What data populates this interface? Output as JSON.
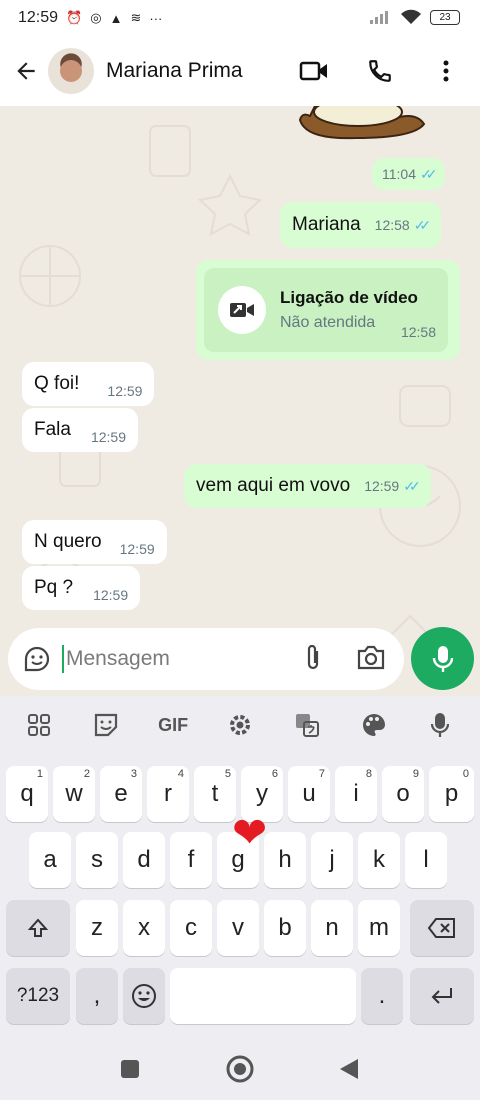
{
  "status_bar": {
    "time": "12:59",
    "battery": "23"
  },
  "header": {
    "contact_name": "Mariana Prima"
  },
  "messages": [
    {
      "dir": "out",
      "text": "",
      "time": "11:04"
    },
    {
      "dir": "out",
      "text": "Mariana",
      "time": "12:58"
    },
    {
      "dir": "out",
      "type": "call",
      "title": "Ligação de vídeo",
      "subtitle": "Não atendida",
      "time": "12:58"
    },
    {
      "dir": "in",
      "text": "Q foi!",
      "time": "12:59"
    },
    {
      "dir": "in",
      "text": "Fala",
      "time": "12:59"
    },
    {
      "dir": "out",
      "text": "vem aqui em vovo",
      "time": "12:59"
    },
    {
      "dir": "in",
      "text": "N quero",
      "time": "12:59"
    },
    {
      "dir": "in",
      "text": "Pq ?",
      "time": "12:59"
    }
  ],
  "compose": {
    "placeholder": "Mensagem"
  },
  "keyboard": {
    "toolbar": {
      "gif_label": "GIF"
    },
    "row1": [
      {
        "k": "q",
        "h": "1"
      },
      {
        "k": "w",
        "h": "2"
      },
      {
        "k": "e",
        "h": "3"
      },
      {
        "k": "r",
        "h": "4"
      },
      {
        "k": "t",
        "h": "5"
      },
      {
        "k": "y",
        "h": "6"
      },
      {
        "k": "u",
        "h": "7"
      },
      {
        "k": "i",
        "h": "8"
      },
      {
        "k": "o",
        "h": "9"
      },
      {
        "k": "p",
        "h": "0"
      }
    ],
    "row2": [
      "a",
      "s",
      "d",
      "f",
      "g",
      "h",
      "j",
      "k",
      "l"
    ],
    "row3": [
      "z",
      "x",
      "c",
      "v",
      "b",
      "n",
      "m"
    ],
    "symbols_label": "?123",
    "comma_label": ",",
    "period_label": "."
  },
  "colors": {
    "accent_green": "#1daa61",
    "outgoing_bubble": "#d9fdd3",
    "read_ticks": "#53bdeb",
    "chat_bg": "#efeae2"
  }
}
